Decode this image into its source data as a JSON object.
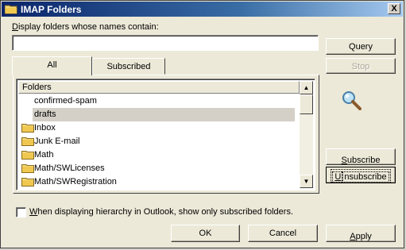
{
  "window": {
    "title": "IMAP Folders",
    "close_label": "X"
  },
  "search": {
    "label_accel": "D",
    "label_rest": "isplay folders whose names contain:",
    "value": ""
  },
  "buttons": {
    "query": "Query",
    "stop": "Stop",
    "subscribe_accel": "S",
    "subscribe_rest": "ubscribe",
    "unsubscribe_accel": "U",
    "unsubscribe_rest": "nsubscribe",
    "ok": "OK",
    "cancel": "Cancel",
    "apply_accel": "A",
    "apply_rest": "pply"
  },
  "tabs": [
    {
      "label": "All",
      "active": true
    },
    {
      "label": "Subscribed",
      "active": false
    }
  ],
  "list": {
    "header": "Folders",
    "rows": [
      {
        "label": "confirmed-spam",
        "icon": "none",
        "selected": false
      },
      {
        "label": "drafts",
        "icon": "none",
        "selected": true
      },
      {
        "label": "Inbox",
        "icon": "folder-icon",
        "selected": false
      },
      {
        "label": "Junk E-mail",
        "icon": "folder-icon",
        "selected": false
      },
      {
        "label": "Math",
        "icon": "folder-icon",
        "selected": false
      },
      {
        "label": "Math/SWLicenses",
        "icon": "folder-icon",
        "selected": false
      },
      {
        "label": "Math/SWRegistration",
        "icon": "folder-icon",
        "selected": false
      }
    ]
  },
  "checkbox": {
    "accel": "W",
    "rest": "hen displaying hierarchy in Outlook, show only subscribed folders.",
    "checked": false
  },
  "colors": {
    "title_start": "#0a246a",
    "title_end": "#a6caf0",
    "selected_row": "#d4d0c8"
  }
}
